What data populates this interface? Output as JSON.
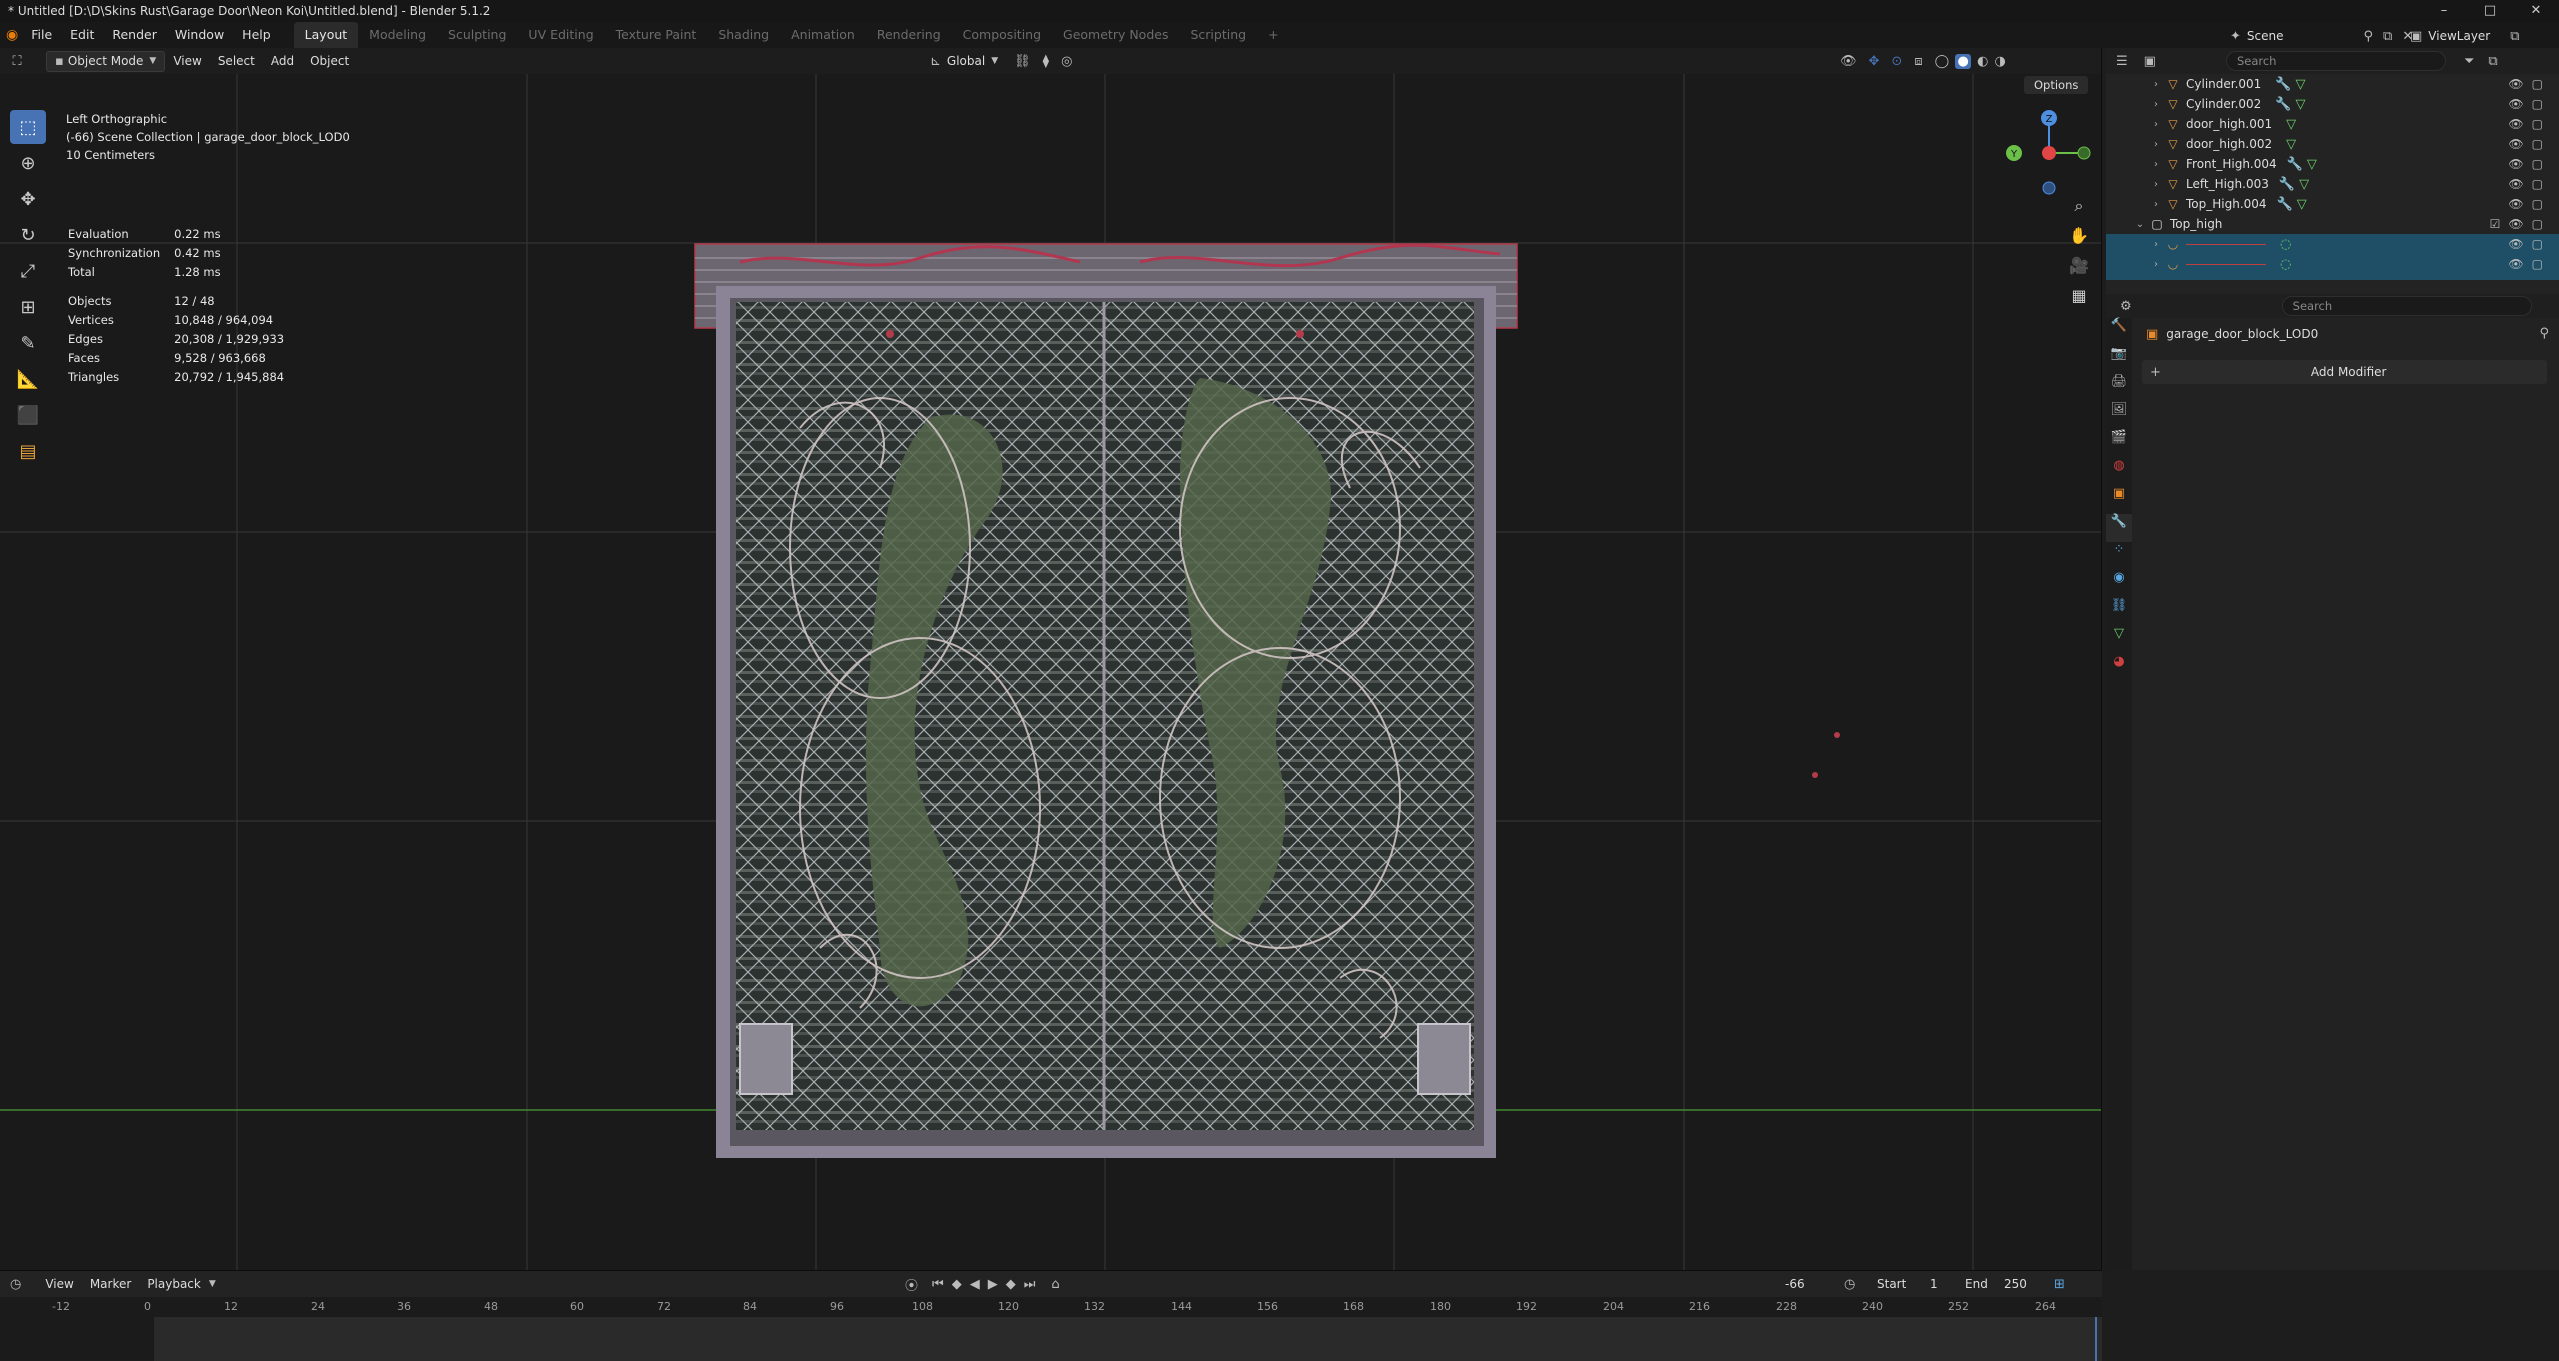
{
  "window": {
    "title": "* Untitled [D:\\D\\Skins Rust\\Garage Door\\Neon Koi\\Untitled.blend] - Blender 5.1.2",
    "controls": [
      "–",
      "□",
      "✕"
    ]
  },
  "menubar": {
    "menus": [
      "File",
      "Edit",
      "Render",
      "Window",
      "Help"
    ],
    "workspaces": [
      "Layout",
      "Modeling",
      "Sculpting",
      "UV Editing",
      "Texture Paint",
      "Shading",
      "Animation",
      "Rendering",
      "Compositing",
      "Geometry Nodes",
      "Scripting"
    ],
    "active_workspace": "Layout",
    "add_workspace": "+",
    "scene": "Scene",
    "view_layer": "ViewLayer"
  },
  "viewport": {
    "mode": "Object Mode",
    "menus": [
      "View",
      "Select",
      "Add",
      "Object"
    ],
    "transform_orientation": "Global",
    "options": "Options",
    "view_name": "Left Orthographic",
    "collection_info": "(-66) Scene Collection | garage_door_block_LOD0",
    "scale_info": "10 Centimeters",
    "timings": [
      {
        "label": "Evaluation",
        "value": "0.22 ms"
      },
      {
        "label": "Synchronization",
        "value": "0.42 ms"
      },
      {
        "label": "Total",
        "value": "1.28 ms"
      }
    ],
    "stats": [
      {
        "label": "Objects",
        "value": "12 / 48"
      },
      {
        "label": "Vertices",
        "value": "10,848 / 964,094"
      },
      {
        "label": "Edges",
        "value": "20,308 / 1,929,933"
      },
      {
        "label": "Faces",
        "value": "9,528 / 963,668"
      },
      {
        "label": "Triangles",
        "value": "20,792 / 1,945,884"
      }
    ],
    "gizmo_axes": {
      "y": "Y",
      "z": "Z"
    }
  },
  "outliner": {
    "search_placeholder": "Search",
    "items": [
      {
        "name": "Cylinder.001",
        "selected": false
      },
      {
        "name": "Cylinder.002",
        "selected": false
      },
      {
        "name": "door_high.001",
        "selected": false
      },
      {
        "name": "door_high.002",
        "selected": false
      },
      {
        "name": "Front_High.004",
        "selected": false
      },
      {
        "name": "Left_High.003",
        "selected": false
      },
      {
        "name": "Top_High.004",
        "selected": false
      }
    ],
    "collection": "Top_high",
    "selected_rows": 3
  },
  "properties": {
    "search_placeholder": "Search",
    "object_name": "garage_door_block_LOD0",
    "add_modifier": "Add Modifier"
  },
  "timeline": {
    "menus": [
      "View",
      "Marker",
      "Playback"
    ],
    "current_frame": "-66",
    "start_label": "Start",
    "start": "1",
    "end_label": "End",
    "end": "250",
    "ruler": [
      "-12",
      "0",
      "12",
      "24",
      "36",
      "48",
      "60",
      "72",
      "84",
      "96",
      "108",
      "120",
      "132",
      "144",
      "156",
      "168",
      "180",
      "192",
      "204",
      "216",
      "228",
      "240",
      "252",
      "264"
    ]
  },
  "colors": {
    "accent": "#4772b3",
    "selection_row": "#1e4f66",
    "x_axis": "#e04646",
    "y_axis": "#6bc04a",
    "z_axis": "#4f8fe0"
  }
}
